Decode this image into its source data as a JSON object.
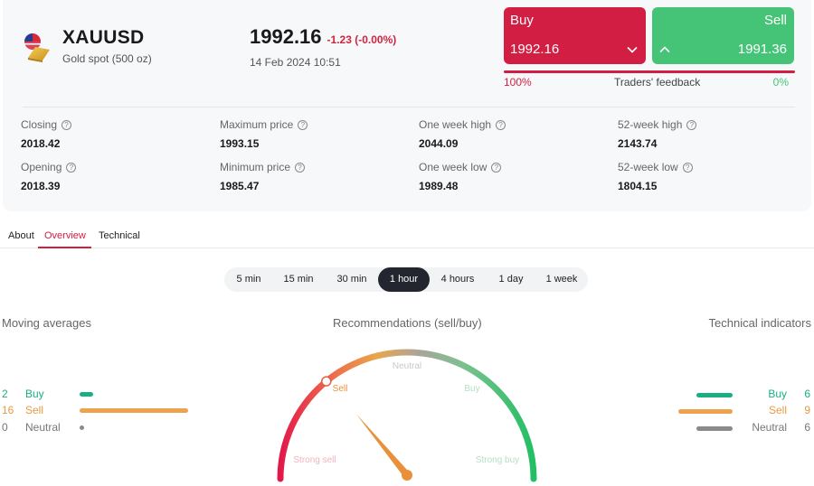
{
  "instrument": {
    "symbol": "XAUUSD",
    "description": "Gold spot (500 oz)"
  },
  "quote": {
    "price": "1992.16",
    "change": "-1.23 (-0.00%)",
    "datetime": "14 Feb 2024 10:51"
  },
  "trade": {
    "buy_label": "Buy",
    "buy_price": "1992.16",
    "sell_label": "Sell",
    "sell_price": "1991.36"
  },
  "feedback": {
    "left_pct": "100%",
    "label": "Traders' feedback",
    "right_pct": "0%",
    "buy_fraction": 1.0
  },
  "stats": {
    "closing": {
      "label": "Closing",
      "value": "2018.42"
    },
    "opening": {
      "label": "Opening",
      "value": "2018.39"
    },
    "max_price": {
      "label": "Maximum price",
      "value": "1993.15"
    },
    "min_price": {
      "label": "Minimum price",
      "value": "1985.47"
    },
    "week_high": {
      "label": "One week high",
      "value": "2044.09"
    },
    "week_low": {
      "label": "One week low",
      "value": "1989.48"
    },
    "year_high": {
      "label": "52-week high",
      "value": "2143.74"
    },
    "year_low": {
      "label": "52-week low",
      "value": "1804.15"
    }
  },
  "tabs": {
    "about": "About",
    "overview": "Overview",
    "technical": "Technical",
    "active": "Overview"
  },
  "timeframes": {
    "items": [
      "5 min",
      "15 min",
      "30 min",
      "1 hour",
      "4 hours",
      "1 day",
      "1 week"
    ],
    "active": "1 hour"
  },
  "moving_averages": {
    "title": "Moving averages",
    "buy": {
      "label": "Buy",
      "count": "2",
      "value": 2
    },
    "sell": {
      "label": "Sell",
      "count": "16",
      "value": 16
    },
    "neutral": {
      "label": "Neutral",
      "count": "0",
      "value": 0
    }
  },
  "recommendations": {
    "title": "Recommendations (sell/buy)",
    "labels": {
      "neutral": "Neutral",
      "sell": "Sell",
      "buy": "Buy",
      "strong_sell": "Strong sell",
      "strong_buy": "Strong buy"
    },
    "needle_value": 0.28
  },
  "technical_indicators": {
    "title": "Technical indicators",
    "buy": {
      "label": "Buy",
      "count": "6",
      "value": 6
    },
    "sell": {
      "label": "Sell",
      "count": "9",
      "value": 9
    },
    "neutral": {
      "label": "Neutral",
      "count": "6",
      "value": 6
    }
  },
  "colors": {
    "sell": "#d21e42",
    "buy": "#45c377",
    "ma_buy": "#1aae84",
    "ma_sell": "#eda24d",
    "neutral": "#8a8a8a",
    "gauge_mid": "#9aa0a0",
    "gauge_needle": "#e8903a"
  }
}
